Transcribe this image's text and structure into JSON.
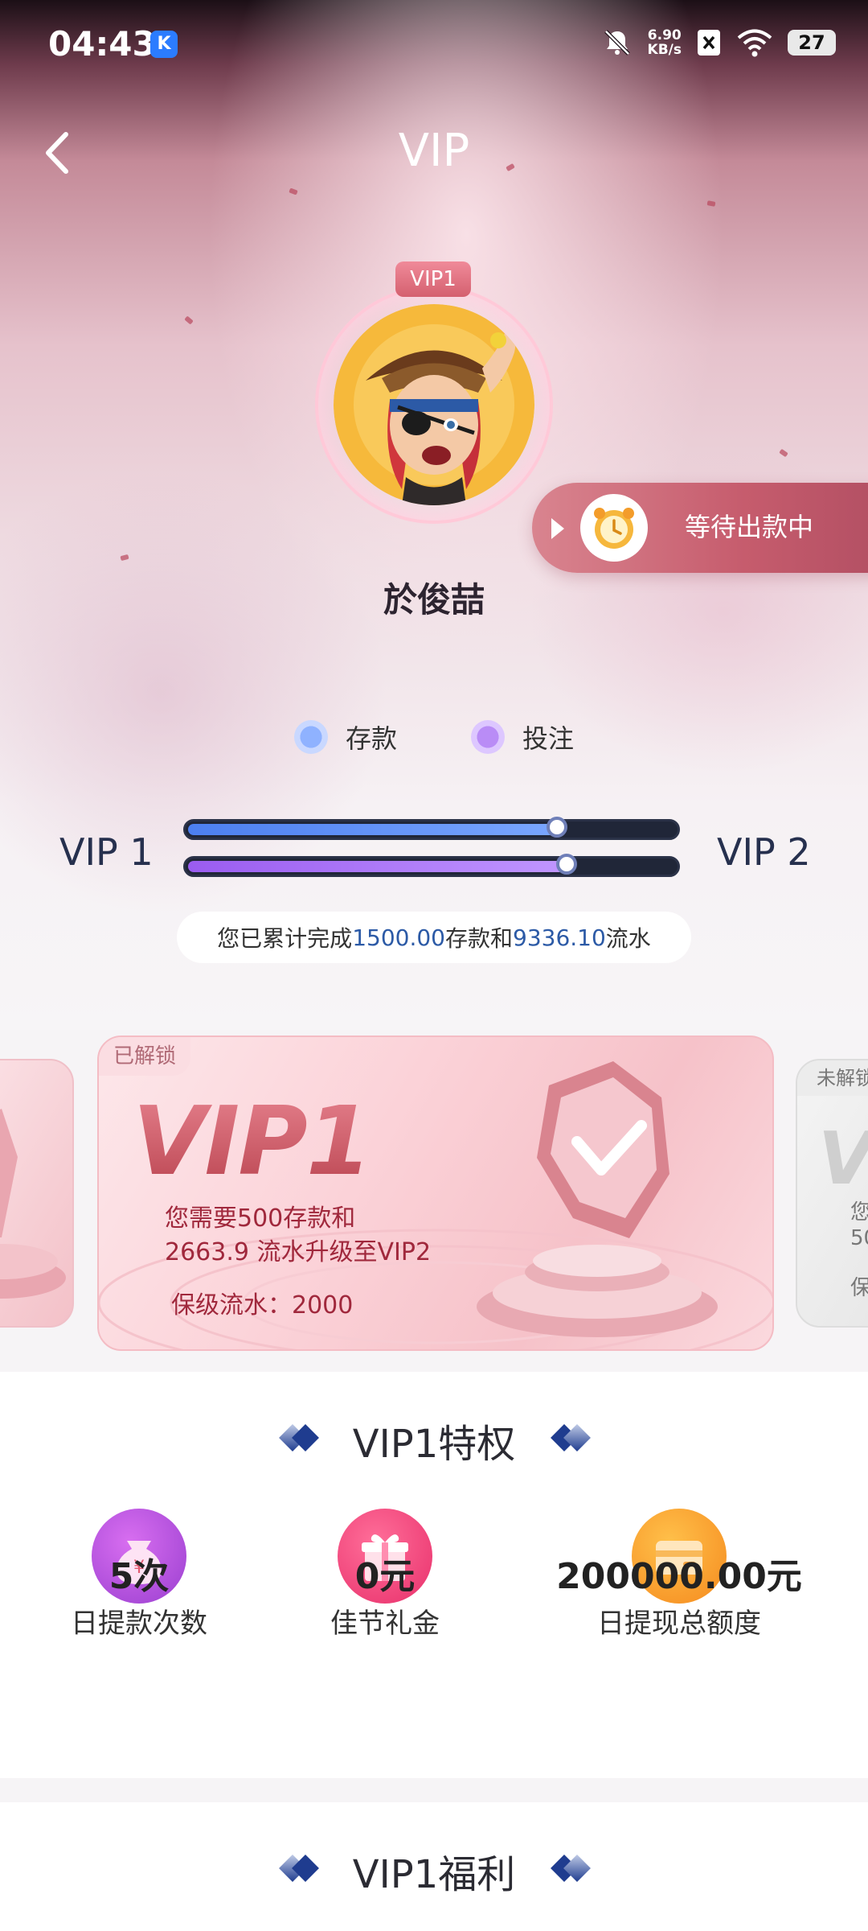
{
  "status_bar": {
    "time": "04:43",
    "app_badge": "K",
    "net_speed_value": "6.90",
    "net_speed_unit": "KB/s",
    "battery": "27"
  },
  "header": {
    "title": "VIP"
  },
  "profile": {
    "vip_badge": "VIP1",
    "username": "於俊喆"
  },
  "pending_withdrawal": {
    "label": "等待出款中"
  },
  "legend": {
    "deposit": "存款",
    "bet": "投注"
  },
  "progress": {
    "current_level": "VIP 1",
    "next_level": "VIP 2",
    "deposit_fraction": 0.75,
    "bet_fraction": 0.77
  },
  "summary": {
    "prefix": "您已累计完成",
    "deposit_amount": "1500.00",
    "middle": "存款和",
    "turnover_amount": "9336.10",
    "suffix": "流水"
  },
  "cards": {
    "current": {
      "tag": "已解锁",
      "level": "VIP1",
      "line1": "您需要500存款和",
      "line2": "2663.9 流水升级至VIP2",
      "retain": "保级流水：2000"
    },
    "next": {
      "tag": "未解锁",
      "letter": "V",
      "line1": "您",
      "line2": "50",
      "line3": "保"
    }
  },
  "privileges": {
    "title": "VIP1特权",
    "items": [
      {
        "value": "5次",
        "label": "日提款次数",
        "icon": "money-bag-icon"
      },
      {
        "value": "0元",
        "label": "佳节礼金",
        "icon": "gift-icon"
      },
      {
        "value": "200000.00元",
        "label": "日提现总额度",
        "icon": "wallet-icon"
      }
    ]
  },
  "benefits": {
    "title": "VIP1福利"
  },
  "colors": {
    "deposit_bar": "#5b8cf2",
    "bet_bar": "#a96df0",
    "accent_pink": "#c65c6d",
    "link_blue": "#2c5aa6"
  }
}
